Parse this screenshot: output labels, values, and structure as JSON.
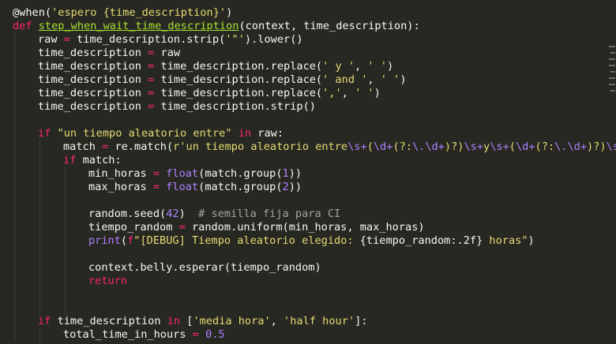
{
  "editor": {
    "language": "python",
    "theme": "monokai",
    "colors": {
      "background": "#272822",
      "foreground": "#f8f8f2",
      "keyword": "#f92672",
      "function_name": "#a6e22e",
      "string": "#e6db74",
      "number": "#ae81ff",
      "comment": "#a5a59c"
    },
    "lines": [
      {
        "indent": 0,
        "tokens": [
          {
            "t": "@when(",
            "c": "dec"
          },
          {
            "t": "'espero {time_description}'",
            "c": "str"
          },
          {
            "t": ")",
            "c": "dec"
          }
        ]
      },
      {
        "indent": 0,
        "tokens": [
          {
            "t": "def ",
            "c": "kw"
          },
          {
            "t": "step_when_wait_time_description",
            "c": "fn"
          },
          {
            "t": "(context, time_description):",
            "c": ""
          }
        ]
      },
      {
        "indent": 1,
        "tokens": [
          {
            "t": "raw ",
            "c": ""
          },
          {
            "t": "=",
            "c": "op"
          },
          {
            "t": " time_description.strip(",
            "c": ""
          },
          {
            "t": "'\"'",
            "c": "str"
          },
          {
            "t": ").lower()",
            "c": ""
          }
        ]
      },
      {
        "indent": 1,
        "tokens": [
          {
            "t": "time_description ",
            "c": ""
          },
          {
            "t": "=",
            "c": "op"
          },
          {
            "t": " raw",
            "c": ""
          }
        ]
      },
      {
        "indent": 1,
        "tokens": [
          {
            "t": "time_description ",
            "c": ""
          },
          {
            "t": "=",
            "c": "op"
          },
          {
            "t": " time_description.replace(",
            "c": ""
          },
          {
            "t": "' y '",
            "c": "str"
          },
          {
            "t": ", ",
            "c": ""
          },
          {
            "t": "' '",
            "c": "str"
          },
          {
            "t": ")",
            "c": ""
          }
        ]
      },
      {
        "indent": 1,
        "tokens": [
          {
            "t": "time_description ",
            "c": ""
          },
          {
            "t": "=",
            "c": "op"
          },
          {
            "t": " time_description.replace(",
            "c": ""
          },
          {
            "t": "' and '",
            "c": "str"
          },
          {
            "t": ", ",
            "c": ""
          },
          {
            "t": "' '",
            "c": "str"
          },
          {
            "t": ")",
            "c": ""
          }
        ]
      },
      {
        "indent": 1,
        "tokens": [
          {
            "t": "time_description ",
            "c": ""
          },
          {
            "t": "=",
            "c": "op"
          },
          {
            "t": " time_description.replace(",
            "c": ""
          },
          {
            "t": "','",
            "c": "str"
          },
          {
            "t": ", ",
            "c": ""
          },
          {
            "t": "' '",
            "c": "str"
          },
          {
            "t": ")",
            "c": ""
          }
        ]
      },
      {
        "indent": 1,
        "tokens": [
          {
            "t": "time_description ",
            "c": ""
          },
          {
            "t": "=",
            "c": "op"
          },
          {
            "t": " time_description.strip()",
            "c": ""
          }
        ]
      },
      {
        "indent": 1,
        "tokens": []
      },
      {
        "indent": 1,
        "tokens": [
          {
            "t": "if ",
            "c": "kw"
          },
          {
            "t": "\"un tiempo aleatorio entre\"",
            "c": "str"
          },
          {
            "t": " in ",
            "c": "kw"
          },
          {
            "t": "raw:",
            "c": ""
          }
        ]
      },
      {
        "indent": 2,
        "tokens": [
          {
            "t": "match ",
            "c": ""
          },
          {
            "t": "=",
            "c": "op"
          },
          {
            "t": " re.match(",
            "c": ""
          },
          {
            "t": "r'un tiempo aleatorio entre",
            "c": "str"
          },
          {
            "t": "\\s+",
            "c": "esc"
          },
          {
            "t": "(",
            "c": "str"
          },
          {
            "t": "\\d+",
            "c": "esc"
          },
          {
            "t": "(?:",
            "c": "str"
          },
          {
            "t": "\\.\\d+",
            "c": "esc"
          },
          {
            "t": ")?)",
            "c": "str"
          },
          {
            "t": "\\s+",
            "c": "esc"
          },
          {
            "t": "y",
            "c": "str"
          },
          {
            "t": "\\s+",
            "c": "esc"
          },
          {
            "t": "(",
            "c": "str"
          },
          {
            "t": "\\d+",
            "c": "esc"
          },
          {
            "t": "(?:",
            "c": "str"
          },
          {
            "t": "\\.\\d+",
            "c": "esc"
          },
          {
            "t": ")?)",
            "c": "str"
          },
          {
            "t": "\\s+",
            "c": "esc"
          }
        ]
      },
      {
        "indent": 2,
        "tokens": [
          {
            "t": "if ",
            "c": "kw"
          },
          {
            "t": "match:",
            "c": ""
          }
        ]
      },
      {
        "indent": 3,
        "tokens": [
          {
            "t": "min_horas ",
            "c": ""
          },
          {
            "t": "=",
            "c": "op"
          },
          {
            "t": " ",
            "c": ""
          },
          {
            "t": "float",
            "c": "bi"
          },
          {
            "t": "(match.group(",
            "c": ""
          },
          {
            "t": "1",
            "c": "num"
          },
          {
            "t": "))",
            "c": ""
          }
        ]
      },
      {
        "indent": 3,
        "tokens": [
          {
            "t": "max_horas ",
            "c": ""
          },
          {
            "t": "=",
            "c": "op"
          },
          {
            "t": " ",
            "c": ""
          },
          {
            "t": "float",
            "c": "bi"
          },
          {
            "t": "(match.group(",
            "c": ""
          },
          {
            "t": "2",
            "c": "num"
          },
          {
            "t": "))",
            "c": ""
          }
        ]
      },
      {
        "indent": 3,
        "tokens": []
      },
      {
        "indent": 3,
        "tokens": [
          {
            "t": "random.seed(",
            "c": ""
          },
          {
            "t": "42",
            "c": "num"
          },
          {
            "t": ")  ",
            "c": ""
          },
          {
            "t": "# semilla fija para CI",
            "c": "cmt"
          }
        ]
      },
      {
        "indent": 3,
        "tokens": [
          {
            "t": "tiempo_random ",
            "c": ""
          },
          {
            "t": "=",
            "c": "op"
          },
          {
            "t": " random.uniform(min_horas, max_horas)",
            "c": ""
          }
        ]
      },
      {
        "indent": 3,
        "tokens": [
          {
            "t": "print",
            "c": "bi"
          },
          {
            "t": "(",
            "c": ""
          },
          {
            "t": "f",
            "c": "kw"
          },
          {
            "t": "\"[DEBUG] Tiempo aleatorio elegido: ",
            "c": "str"
          },
          {
            "t": "{tiempo_random:.2f}",
            "c": ""
          },
          {
            "t": " horas\"",
            "c": "str"
          },
          {
            "t": ")",
            "c": ""
          }
        ]
      },
      {
        "indent": 3,
        "tokens": []
      },
      {
        "indent": 3,
        "tokens": [
          {
            "t": "context.belly.esperar(tiempo_random)",
            "c": ""
          }
        ]
      },
      {
        "indent": 3,
        "tokens": [
          {
            "t": "return",
            "c": "kw"
          }
        ]
      },
      {
        "indent": 0,
        "tokens": []
      },
      {
        "indent": 0,
        "tokens": []
      },
      {
        "indent": 1,
        "tokens": [
          {
            "t": "if ",
            "c": "kw"
          },
          {
            "t": "time_description ",
            "c": ""
          },
          {
            "t": "in ",
            "c": "kw"
          },
          {
            "t": "[",
            "c": ""
          },
          {
            "t": "'media hora'",
            "c": "str"
          },
          {
            "t": ", ",
            "c": ""
          },
          {
            "t": "'half hour'",
            "c": "str"
          },
          {
            "t": "]:",
            "c": ""
          }
        ]
      },
      {
        "indent": 2,
        "tokens": [
          {
            "t": "total_time_in_hours ",
            "c": ""
          },
          {
            "t": "=",
            "c": "op"
          },
          {
            "t": " ",
            "c": ""
          },
          {
            "t": "0.5",
            "c": "num"
          }
        ]
      }
    ]
  }
}
